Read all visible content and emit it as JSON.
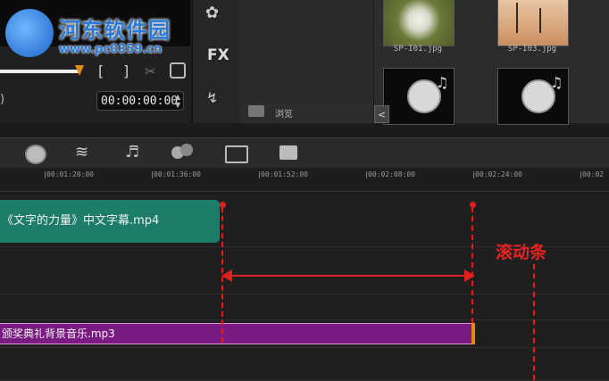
{
  "watermark": {
    "title": "河东软件园",
    "url": "www.pc0359.cn"
  },
  "preview": {
    "bracket_in": "[",
    "bracket_out": "]",
    "timecode": "00:00:00:00"
  },
  "library_tools": {
    "fx_label": "FX"
  },
  "browse": {
    "label": "浏览"
  },
  "thumbnails": [
    {
      "label": "SP-I01.jpg"
    },
    {
      "label": "SP-I03.jpg"
    }
  ],
  "ruler": {
    "ticks": [
      "00:01:20:00",
      "00:01:36:00",
      "00:01:52:00",
      "00:02:08:00",
      "00:02:24:00",
      "00:02"
    ]
  },
  "tracks": {
    "video_clip": "《文字的力量》中文字幕.mp4",
    "audio_clip": "颁奖典礼背景音乐.mp3"
  },
  "annotation": {
    "label": "滚动条",
    "color": "#e02020"
  },
  "colors": {
    "video_clip": "#1e7d6a",
    "audio_clip": "#7a1a83",
    "playhead": "#e08a1e"
  }
}
